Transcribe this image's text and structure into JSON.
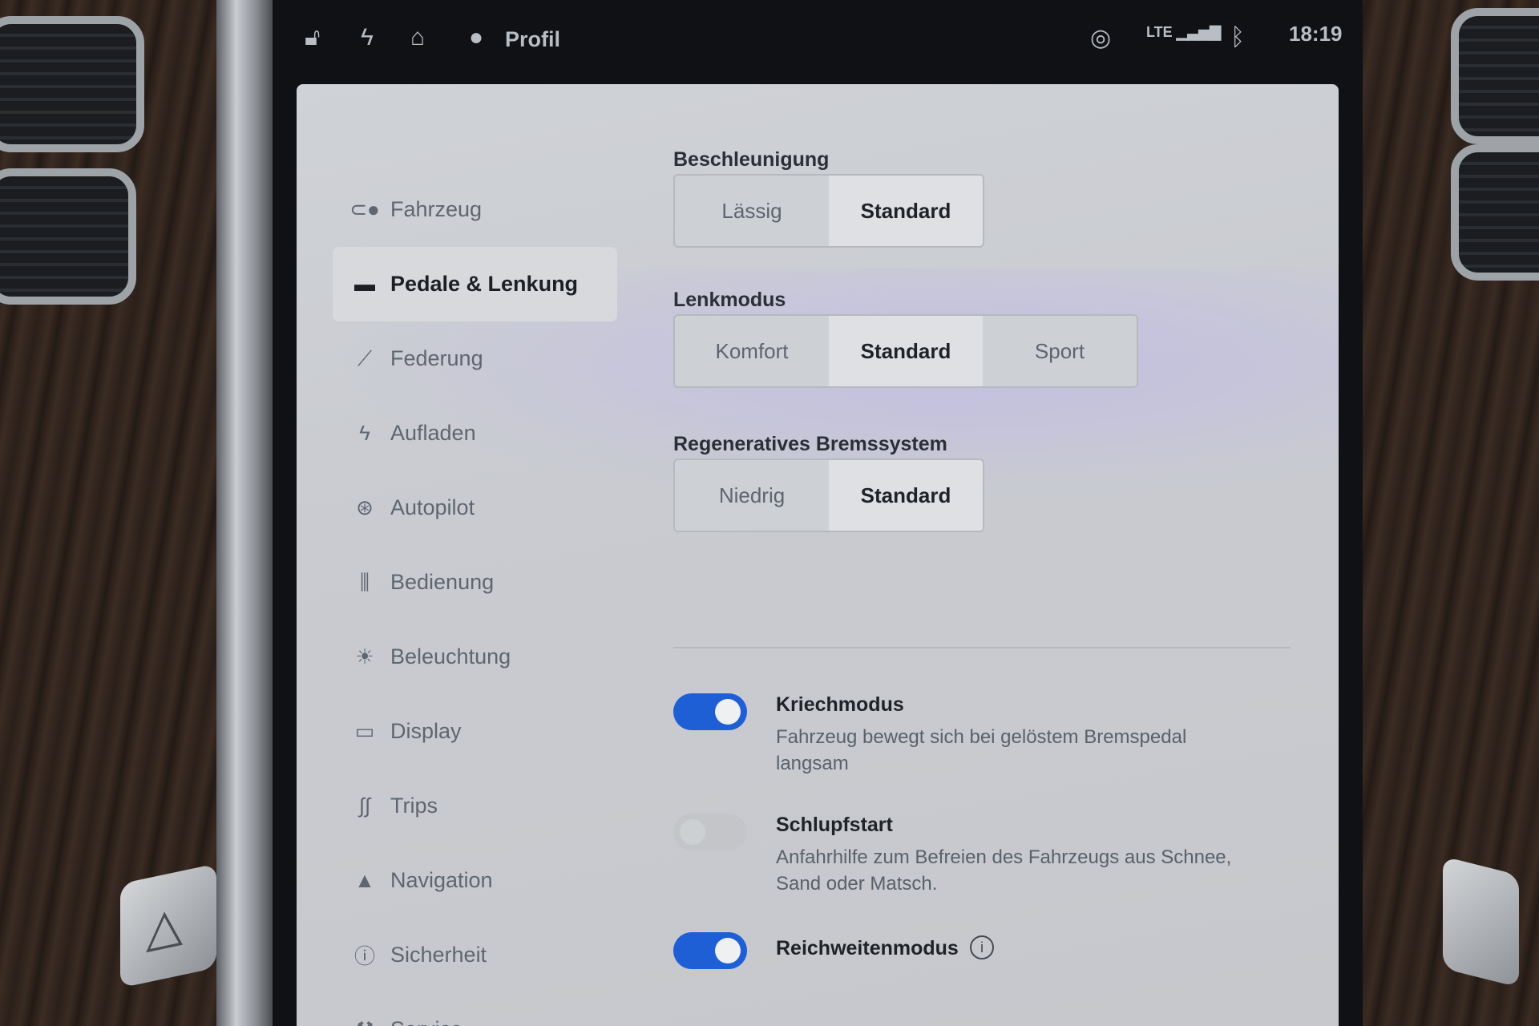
{
  "statusbar": {
    "profile_label": "Profil",
    "network": "LTE",
    "time": "18:19",
    "icons": [
      "lock-icon",
      "bolt-icon",
      "home-icon",
      "person-icon",
      "record-icon",
      "signal-icon",
      "bluetooth-icon"
    ]
  },
  "sidebar": {
    "items": [
      {
        "label": "Fahrzeug",
        "icon": "toggle-icon"
      },
      {
        "label": "Pedale & Lenkung",
        "icon": "car-icon",
        "active": true
      },
      {
        "label": "Federung",
        "icon": "suspension-icon"
      },
      {
        "label": "Aufladen",
        "icon": "bolt-icon"
      },
      {
        "label": "Autopilot",
        "icon": "steering-wheel-icon"
      },
      {
        "label": "Bedienung",
        "icon": "sliders-icon"
      },
      {
        "label": "Beleuchtung",
        "icon": "sun-icon"
      },
      {
        "label": "Display",
        "icon": "display-icon"
      },
      {
        "label": "Trips",
        "icon": "trips-icon"
      },
      {
        "label": "Navigation",
        "icon": "navigation-icon"
      },
      {
        "label": "Sicherheit",
        "icon": "info-circle-icon"
      },
      {
        "label": "Service",
        "icon": "wrench-icon"
      }
    ]
  },
  "settings": {
    "acceleration": {
      "title": "Beschleunigung",
      "options": [
        "Lässig",
        "Standard"
      ],
      "selected": "Standard"
    },
    "steering": {
      "title": "Lenkmodus",
      "options": [
        "Komfort",
        "Standard",
        "Sport"
      ],
      "selected": "Standard"
    },
    "regen": {
      "title": "Regeneratives Bremssystem",
      "options": [
        "Niedrig",
        "Standard"
      ],
      "selected": "Standard"
    },
    "toggles": [
      {
        "title": "Kriechmodus",
        "description": "Fahrzeug bewegt sich bei gelöstem Bremspedal langsam",
        "on": true
      },
      {
        "title": "Schlupfstart",
        "description": "Anfahrhilfe zum Befreien des Fahrzeugs aus Schnee, Sand oder Matsch.",
        "on": false
      },
      {
        "title": "Reichweitenmodus",
        "description": "",
        "on": true,
        "info_icon": "info-icon"
      }
    ]
  },
  "colors": {
    "toggle_on": "#1f5fd6",
    "panel_bg": "#cfd2d6",
    "accent_text": "#1f2328"
  }
}
